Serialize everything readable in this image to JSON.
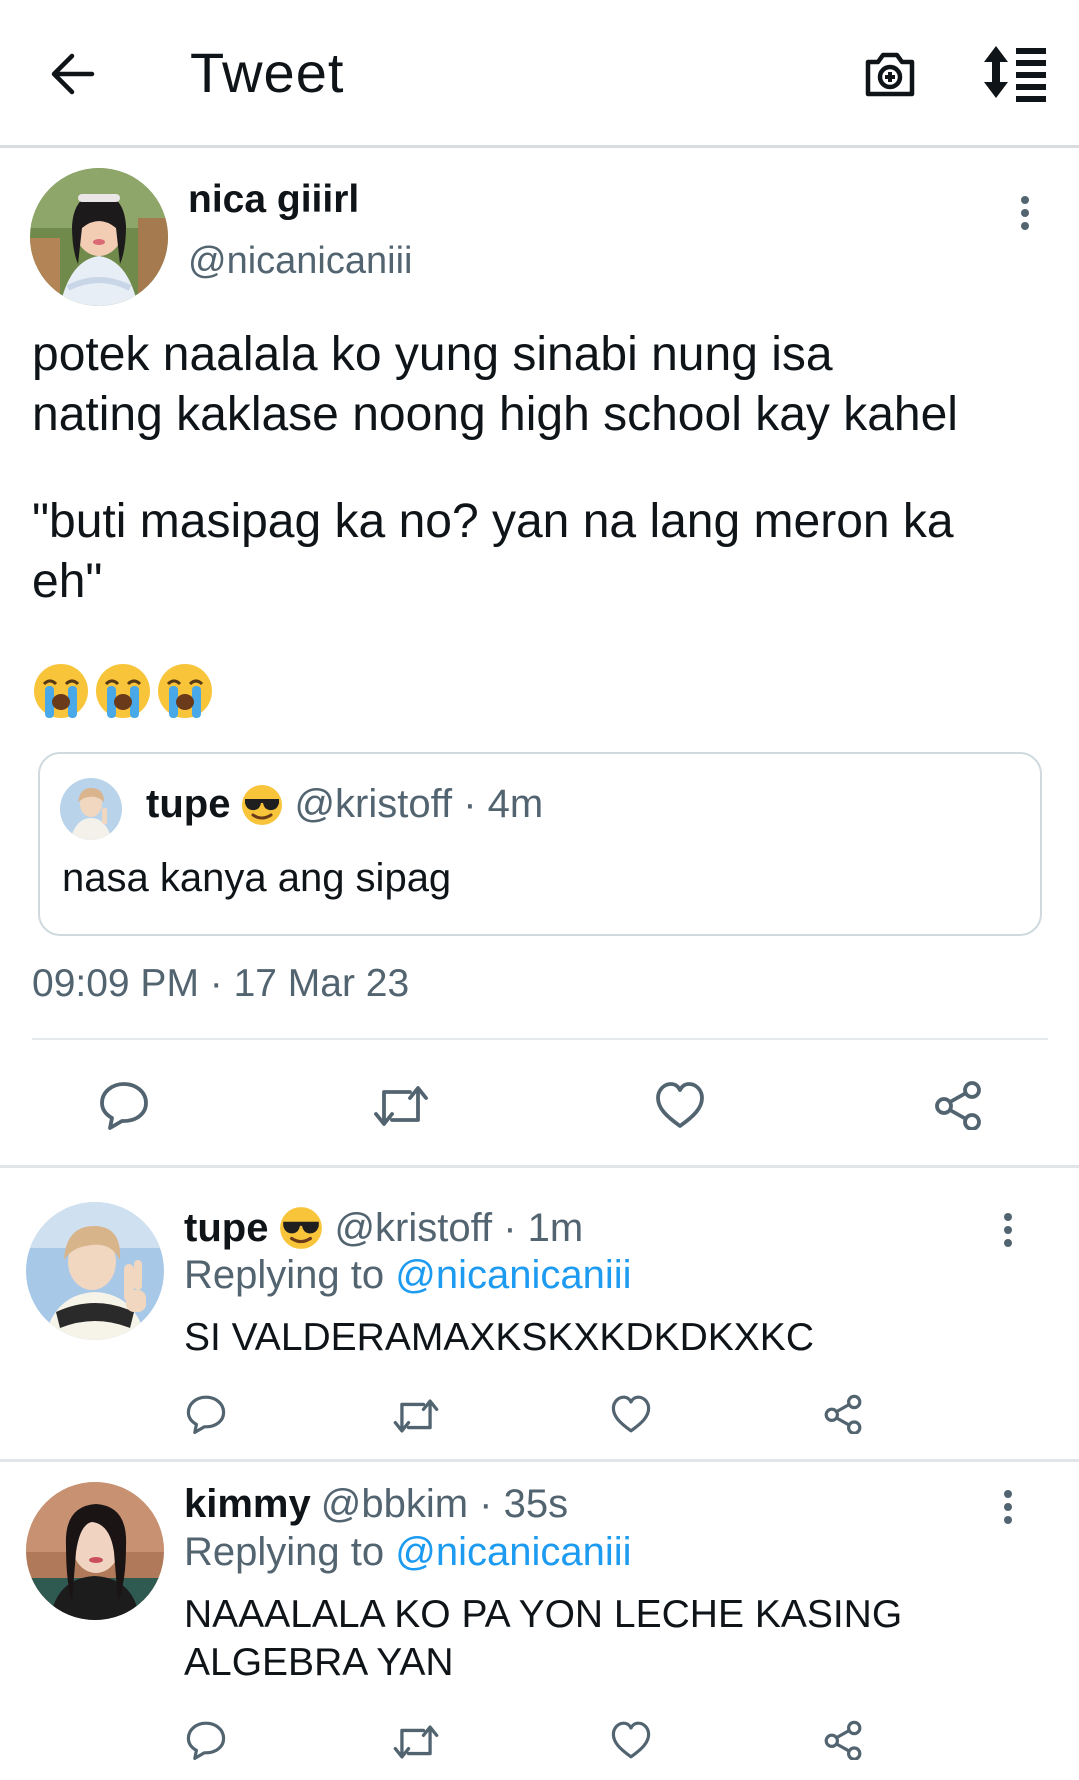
{
  "header": {
    "title": "Tweet",
    "back_icon": "arrow-left-icon",
    "camera_icon": "camera-plus-icon",
    "sort_icon": "sort-list-icon"
  },
  "tweet": {
    "author_name": "nica giiirl",
    "author_handle": "@nicanicaniii",
    "text_line1": "potek naalala ko yung sinabi nung isa",
    "text_line2": "nating kaklase noong high school kay kahel",
    "text_line3": "\"buti masipag ka no? yan na lang meron ka",
    "text_line4": "eh\"",
    "emojis": [
      "loudly-crying-face",
      "loudly-crying-face",
      "loudly-crying-face"
    ],
    "quoted": {
      "author_name": "tupe",
      "author_emoji": "sunglasses-face",
      "handle_time": "@kristoff · 4m",
      "text": "nasa kanya ang sipag"
    },
    "timestamp": "09:09 PM · 17 Mar 23"
  },
  "replies": [
    {
      "author_name": "tupe",
      "author_emoji": "sunglasses-face",
      "handle_time": "@kristoff · 1m",
      "replying_prefix": "Replying to",
      "replying_to": "@nicanicaniii",
      "text": "SI VALDERAMAXKSKXKDKDKXKC"
    },
    {
      "author_name": "kimmy",
      "handle_time": "@bbkim · 35s",
      "replying_prefix": "Replying to",
      "replying_to": "@nicanicaniii",
      "text_line1": "NAAALALA KO PA YON LECHE KASING",
      "text_line2": "ALGEBRA YAN"
    }
  ],
  "colors": {
    "text": "#0f1419",
    "secondary": "#536471",
    "link": "#1d9bf0",
    "border": "#cfd9de"
  }
}
